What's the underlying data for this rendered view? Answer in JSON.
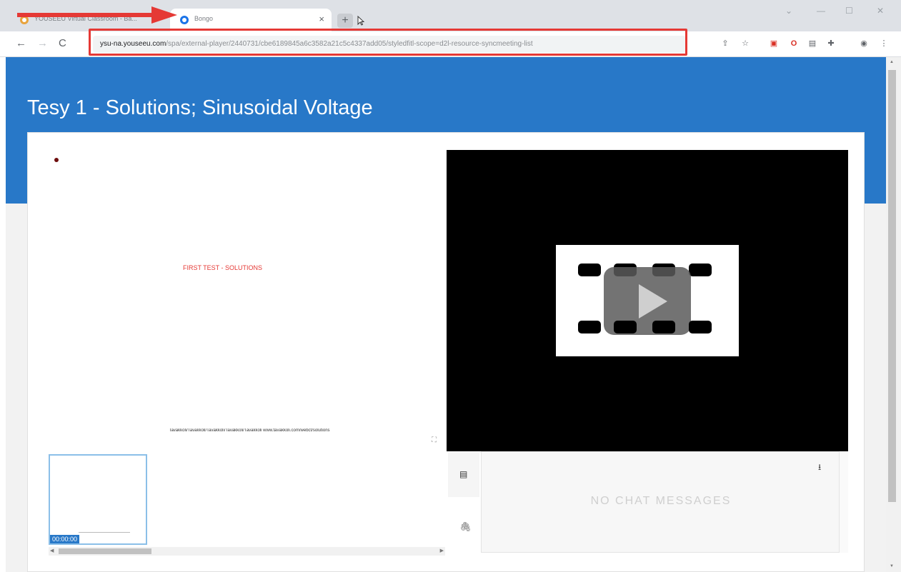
{
  "browser": {
    "tabs": [
      {
        "title": "YOUSEEU Virtual Classroom - Ba...",
        "active": false
      },
      {
        "title": "Bongo",
        "active": true
      }
    ],
    "new_tab_symbol": "+",
    "close_symbol": "×",
    "url_host": "ysu-na.youseeu.com",
    "url_path": "/spa/external-player/2440731/cbe6189845a6c3582a21c5c4337add05/styledfitl-scope=d2l-resource-syncmeeting-list",
    "nav": {
      "back": "←",
      "forward": "→",
      "reload": "C"
    },
    "window_controls": [
      "⌄",
      "—",
      "☐",
      "✕"
    ],
    "extensions": [
      "share-icon",
      "star-icon",
      "pdf-icon",
      "opera-icon",
      "bookmark-icon",
      "puzzle-icon",
      "profile-icon",
      "menu-icon"
    ],
    "highlight_color": "#e53935"
  },
  "page": {
    "title": "Tesy 1 - Solutions; Sinusoidal Voltage",
    "banner_color": "#2878c8",
    "slide": {
      "heading": "FIRST TEST - SOLUTIONS",
      "footer": "Tavakkoli/Tavakkoli/Tavakkoli/Tavakkoli/Tavakkoli www.tavakkoli.com/webct/solutions",
      "thumbnail_time": "00:00:00"
    },
    "chat": {
      "empty_message": "NO CHAT MESSAGES"
    }
  }
}
